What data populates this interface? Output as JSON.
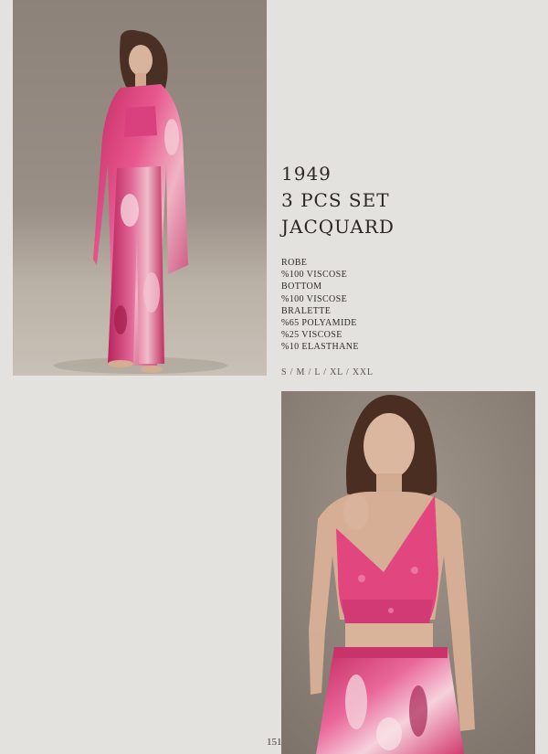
{
  "product": {
    "title_lines": [
      "1949",
      "3 PCS SET",
      "JACQUARD"
    ],
    "specs": [
      "ROBE",
      "%100 VISCOSE",
      "BOTTOM",
      "%100 VISCOSE",
      "BRALETTE",
      "%65 POLYAMIDE",
      "%25 VISCOSE",
      "%10 ELASTHANE"
    ],
    "sizes": "S / M / L / XL / XXL"
  },
  "page": {
    "number": "151"
  },
  "photos": {
    "top": "full-length model wearing pink floral robe set",
    "bottom": "close-up of model wearing pink lace bralette and printed pants"
  },
  "colors": {
    "background": "#e4e2de",
    "print_pink": "#d4357a",
    "print_deep": "#b8245d",
    "print_light": "#f2c7d3",
    "studio_backdrop": "#8c7f75"
  }
}
